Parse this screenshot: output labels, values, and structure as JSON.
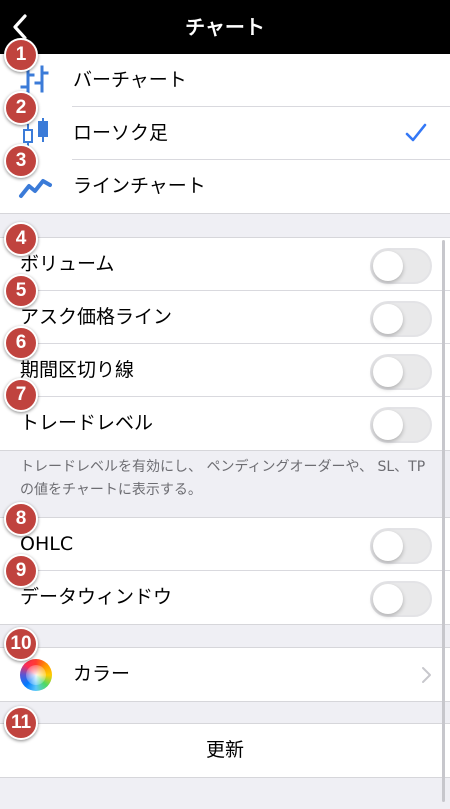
{
  "header": {
    "title": "チャート",
    "back_icon": "chevron-left-icon"
  },
  "chart_type": {
    "items": [
      {
        "label": "バーチャート",
        "icon": "bar-chart-icon",
        "selected": false
      },
      {
        "label": "ローソク足",
        "icon": "candlestick-icon",
        "selected": true
      },
      {
        "label": "ラインチャート",
        "icon": "line-chart-icon",
        "selected": false
      }
    ]
  },
  "toggles": {
    "items": [
      {
        "label": "ボリューム",
        "on": false
      },
      {
        "label": "アスク価格ライン",
        "on": false
      },
      {
        "label": "期間区切り線",
        "on": false
      },
      {
        "label": "トレードレベル",
        "on": false
      }
    ],
    "footnote": "トレードレベルを有効にし、 ペンディングオーダーや、 SL、TP の値をチャートに表示する。"
  },
  "toggles2": {
    "items": [
      {
        "label": "OHLC",
        "on": false
      },
      {
        "label": "データウィンドウ",
        "on": false
      }
    ]
  },
  "color_row": {
    "label": "カラー",
    "icon": "color-wheel-icon"
  },
  "update_row": {
    "label": "更新"
  },
  "badges": [
    "1",
    "2",
    "3",
    "4",
    "5",
    "6",
    "7",
    "8",
    "9",
    "10",
    "11"
  ],
  "colors": {
    "accent": "#3478f6",
    "badge": "#c0433e",
    "nav": "#000000",
    "background": "#efeff4"
  }
}
